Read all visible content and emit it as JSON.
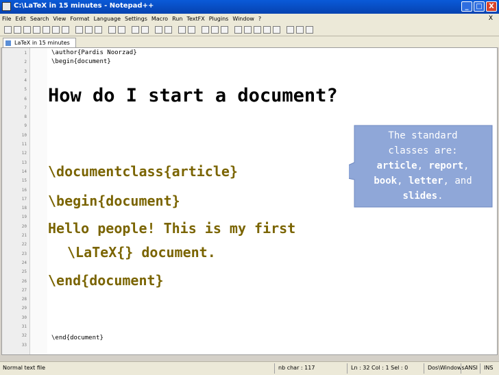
{
  "window": {
    "title": "C:\\LaTeX in 15 minutes - Notepad++",
    "minimize": "_",
    "maximize": "□",
    "close": "X"
  },
  "menu": [
    "File",
    "Edit",
    "Search",
    "View",
    "Format",
    "Language",
    "Settings",
    "Macro",
    "Run",
    "TextFX",
    "Plugins",
    "Window",
    "?"
  ],
  "menu_doc_close": "X",
  "tab": {
    "label": "LaTeX in 15 minutes"
  },
  "line_numbers": [
    "1",
    "2",
    "3",
    "4",
    "5",
    "6",
    "7",
    "8",
    "9",
    "10",
    "11",
    "12",
    "13",
    "14",
    "15",
    "16",
    "17",
    "18",
    "19",
    "20",
    "21",
    "22",
    "23",
    "24",
    "25",
    "26",
    "27",
    "28",
    "29",
    "30",
    "31",
    "32",
    "33"
  ],
  "code": {
    "line1": "\\author{Pardis Noorzad}",
    "line2": "\\begin{document}",
    "line32": "\\end{document}"
  },
  "slide": {
    "heading": "How do I start a document?",
    "line_documentclass": "\\documentclass{article}",
    "line_begin": "\\begin{document}",
    "line_hello": "Hello people!  This is my first",
    "line_latex": "\\LaTeX{} document.",
    "line_end": "\\end{document}"
  },
  "callout": {
    "line1": "The standard",
    "line2": "classes are:",
    "article": "article",
    "comma1": ", ",
    "report": "report",
    "comma2": ",",
    "book": "book",
    "comma3": ", ",
    "letter": "letter",
    "comma4": ", ",
    "and": "and",
    "slides": "slides",
    "period": "."
  },
  "status": {
    "filetype": "Normal text file",
    "nb_char": "nb char : 117",
    "position": "Ln : 32   Col : 1   Sel : 0",
    "eol": "Dos\\Windows",
    "encoding": "ANSI",
    "mode": "INS"
  },
  "colors": {
    "callout_fill": "#8fa7d8",
    "latex_text": "#7a6400"
  }
}
